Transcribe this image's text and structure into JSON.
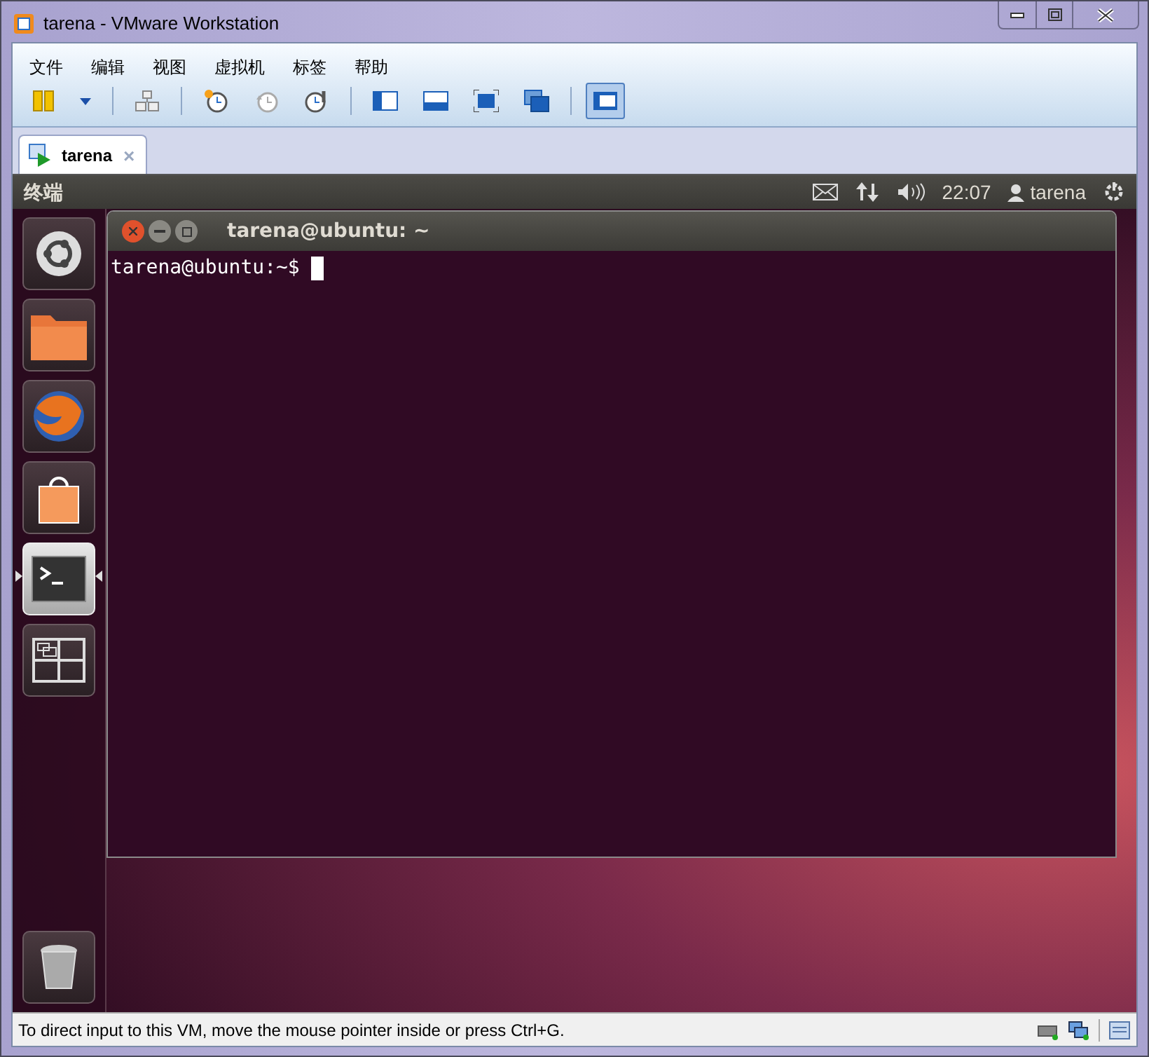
{
  "window": {
    "title": "tarena - VMware Workstation"
  },
  "menu": [
    "文件",
    "编辑",
    "视图",
    "虚拟机",
    "标签",
    "帮助"
  ],
  "toolbar": [
    {
      "kind": "pause",
      "selected": false
    },
    {
      "kind": "dropdown",
      "selected": false
    },
    {
      "kind": "sep"
    },
    {
      "kind": "network",
      "selected": false
    },
    {
      "kind": "sep"
    },
    {
      "kind": "snapshot",
      "selected": false
    },
    {
      "kind": "revert",
      "selected": false
    },
    {
      "kind": "manager",
      "selected": false
    },
    {
      "kind": "sep"
    },
    {
      "kind": "sidebar",
      "selected": false
    },
    {
      "kind": "bottombar",
      "selected": false
    },
    {
      "kind": "fullscreen",
      "selected": false
    },
    {
      "kind": "unity",
      "selected": false
    },
    {
      "kind": "sep"
    },
    {
      "kind": "console",
      "selected": true
    }
  ],
  "tabs": [
    {
      "label": "tarena",
      "selected": true,
      "close": "×"
    }
  ],
  "panel": {
    "app_title": "终端",
    "time": "22:07",
    "user": "tarena"
  },
  "launcher": [
    {
      "kind": "dash",
      "selected": false
    },
    {
      "kind": "files",
      "selected": false
    },
    {
      "kind": "browser",
      "selected": false
    },
    {
      "kind": "software",
      "selected": false
    },
    {
      "kind": "terminal",
      "selected": true
    },
    {
      "kind": "workspaces",
      "selected": false
    }
  ],
  "terminal": {
    "title": "tarena@ubuntu: ~",
    "prompt": "tarena@ubuntu:~$"
  },
  "status_bar": {
    "message": "To direct input to this VM, move the mouse pointer inside or press Ctrl+G."
  }
}
